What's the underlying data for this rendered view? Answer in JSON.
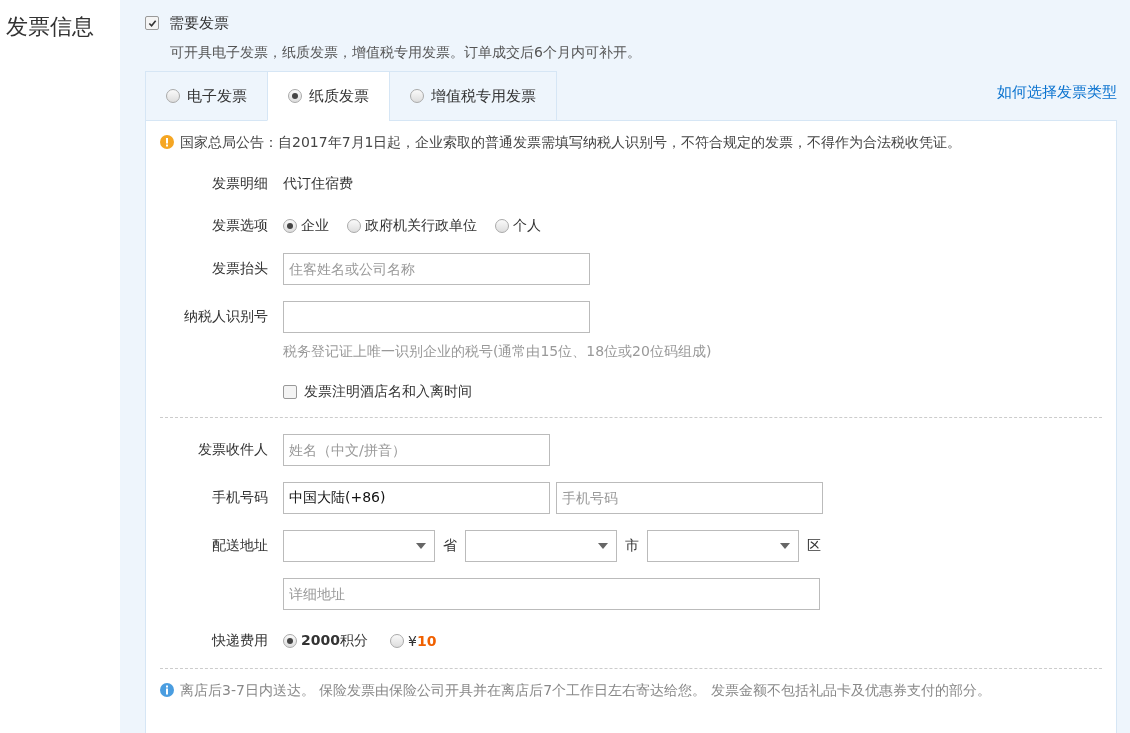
{
  "section_title": "发票信息",
  "need_invoice": {
    "label": "需要发票",
    "checked": true
  },
  "description": "可开具电子发票，纸质发票，增值税专用发票。订单成交后6个月内可补开。",
  "tabs": [
    {
      "label": "电子发票",
      "selected": false
    },
    {
      "label": "纸质发票",
      "selected": true
    },
    {
      "label": "增值税专用发票",
      "selected": false
    }
  ],
  "help_link": "如何选择发票类型",
  "notice": "国家总局公告：自2017年7月1日起，企业索取的普通发票需填写纳税人识别号，不符合规定的发票，不得作为合法税收凭证。",
  "detail": {
    "label": "发票明细",
    "value": "代订住宿费"
  },
  "options": {
    "label": "发票选项",
    "items": [
      {
        "label": "企业",
        "selected": true
      },
      {
        "label": "政府机关行政单位",
        "selected": false
      },
      {
        "label": "个人",
        "selected": false
      }
    ]
  },
  "invoice_title": {
    "label": "发票抬头",
    "placeholder": "住客姓名或公司名称"
  },
  "taxpayer_id": {
    "label": "纳税人识别号",
    "hint": "税务登记证上唯一识别企业的税号(通常由15位、18位或20位码组成)"
  },
  "annotate": {
    "label": "发票注明酒店名和入离时间",
    "checked": false
  },
  "recipient": {
    "label": "发票收件人",
    "placeholder": "姓名（中文/拼音）"
  },
  "phone": {
    "label": "手机号码",
    "country": "中国大陆(+86)",
    "placeholder": "手机号码"
  },
  "address": {
    "label": "配送地址",
    "selects": [
      {
        "unit": "省"
      },
      {
        "unit": "市"
      },
      {
        "unit": "区"
      }
    ],
    "detail_placeholder": "详细地址"
  },
  "shipping": {
    "label": "快递费用",
    "items": [
      {
        "kind": "points",
        "text": "**2000**积分",
        "selected": true
      },
      {
        "kind": "price",
        "currency": "¥",
        "amount": "10",
        "selected": false
      }
    ]
  },
  "footer_note": "离店后3-7日内送达。 保险发票由保险公司开具并在离店后7个工作日左右寄达给您。 发票金额不包括礼品卡及优惠券支付的部分。"
}
